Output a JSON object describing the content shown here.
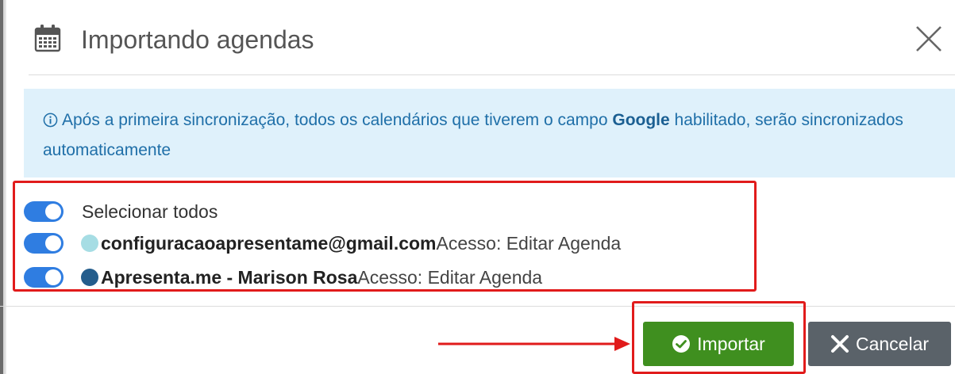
{
  "dialog": {
    "title": "Importando agendas",
    "icons": {
      "header": "calendar-icon",
      "close": "close-icon"
    }
  },
  "alert": {
    "icon": "info-circle-icon",
    "text_before": "Após a primeira sincronização, todos os calendários que tiverem o campo ",
    "highlight": "Google",
    "text_after": " habilitado, serão sincronizados automaticamente"
  },
  "list": {
    "select_all": {
      "label": "Selecionar todos",
      "enabled": true
    },
    "calendars": [
      {
        "name": "configuracaoapresentame@gmail.com",
        "access": "Acesso: Editar Agenda",
        "color": "#a6dde4",
        "enabled": true
      },
      {
        "name": "Apresenta.me - Marison Rosa",
        "access": "Acesso: Editar Agenda",
        "color": "#245d8c",
        "enabled": true
      }
    ]
  },
  "buttons": {
    "import": {
      "label": "Importar",
      "icon": "check-circle-icon",
      "color": "#3f8f1f"
    },
    "cancel": {
      "label": "Cancelar",
      "icon": "x-icon",
      "color": "#5a6269"
    }
  },
  "colors": {
    "highlight_border": "#e11b1b",
    "toggle_on": "#2f7de1",
    "alert_bg": "#dff1fb",
    "alert_text": "#1f6fa8"
  }
}
